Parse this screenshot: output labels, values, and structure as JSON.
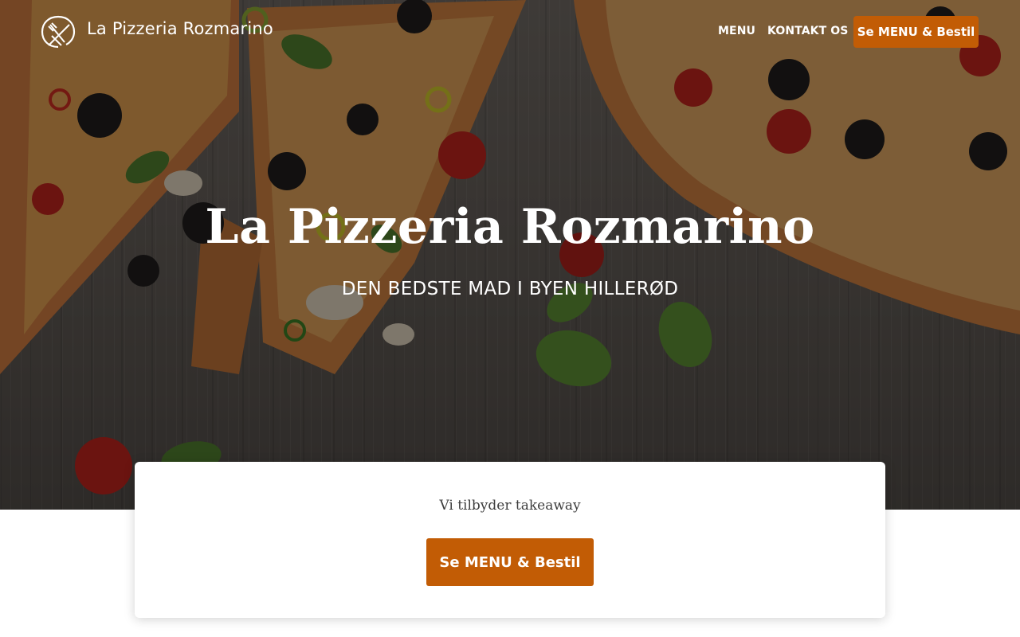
{
  "header": {
    "brand": "La Pizzeria Rozmarino",
    "logo_icon": "fork-and-knife-circle-icon",
    "nav": {
      "menu": "MENU",
      "contact": "KONTAKT OS"
    },
    "cta": "Se MENU & Bestil"
  },
  "hero": {
    "background": "pizza-on-wooden-table-photo",
    "title": "La Pizzeria Rozmarino",
    "subtitle": "DEN BEDSTE MAD I BYEN HILLERØD"
  },
  "card": {
    "text": "Vi tilbyder takeaway",
    "cta": "Se MENU & Bestil"
  },
  "colors": {
    "accent": "#c25c05",
    "overlay": "#000000",
    "text_dark": "#3d3d3d"
  }
}
